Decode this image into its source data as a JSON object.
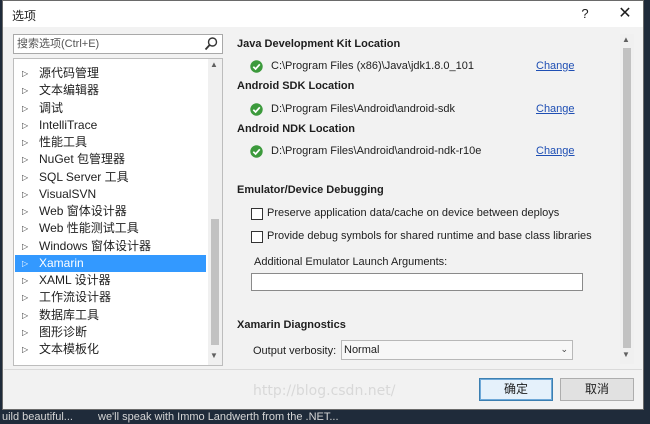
{
  "window": {
    "title": "选项",
    "help_glyph": "?",
    "close_glyph": "✕"
  },
  "search": {
    "placeholder": "搜索选项(Ctrl+E)",
    "icon": "search-icon"
  },
  "tree": {
    "items": [
      {
        "label": "源代码管理",
        "selected": false
      },
      {
        "label": "文本编辑器",
        "selected": false
      },
      {
        "label": "调试",
        "selected": false
      },
      {
        "label": "IntelliTrace",
        "selected": false
      },
      {
        "label": "性能工具",
        "selected": false
      },
      {
        "label": "NuGet 包管理器",
        "selected": false
      },
      {
        "label": "SQL Server 工具",
        "selected": false
      },
      {
        "label": "VisualSVN",
        "selected": false
      },
      {
        "label": "Web 窗体设计器",
        "selected": false
      },
      {
        "label": "Web 性能测试工具",
        "selected": false
      },
      {
        "label": "Windows 窗体设计器",
        "selected": false
      },
      {
        "label": "Xamarin",
        "selected": true
      },
      {
        "label": "XAML 设计器",
        "selected": false
      },
      {
        "label": "工作流设计器",
        "selected": false
      },
      {
        "label": "数据库工具",
        "selected": false
      },
      {
        "label": "图形诊断",
        "selected": false
      },
      {
        "label": "文本模板化",
        "selected": false
      }
    ]
  },
  "sdk": {
    "jdk": {
      "title": "Java Development Kit Location",
      "path": "C:\\Program Files (x86)\\Java\\jdk1.8.0_101",
      "link": "Change"
    },
    "android_sdk": {
      "title": "Android SDK Location",
      "path": "D:\\Program Files\\Android\\android-sdk",
      "link": "Change"
    },
    "android_ndk": {
      "title": "Android NDK Location",
      "path": "D:\\Program Files\\Android\\android-ndk-r10e",
      "link": "Change"
    }
  },
  "emulator": {
    "title": "Emulator/Device Debugging",
    "preserve_label": "Preserve application data/cache on device between deploys",
    "preserve_checked": false,
    "symbols_label": "Provide debug symbols for shared runtime and base class libraries",
    "symbols_checked": false,
    "args_label": "Additional Emulator Launch Arguments:",
    "args_value": ""
  },
  "diagnostics": {
    "title": "Xamarin Diagnostics",
    "verbosity_label": "Output verbosity:",
    "verbosity_value": "Normal"
  },
  "buttons": {
    "ok": "确定",
    "cancel": "取消"
  },
  "background": {
    "left_text": "uild beautiful...",
    "right_text": "we'll speak with Immo Landwerth from the .NET...",
    "watermark": "http://blog.csdn.net/"
  },
  "colors": {
    "selected_bg": "#3399ff",
    "check_green": "#3c9a3c",
    "link_blue": "#1f4fb4"
  }
}
